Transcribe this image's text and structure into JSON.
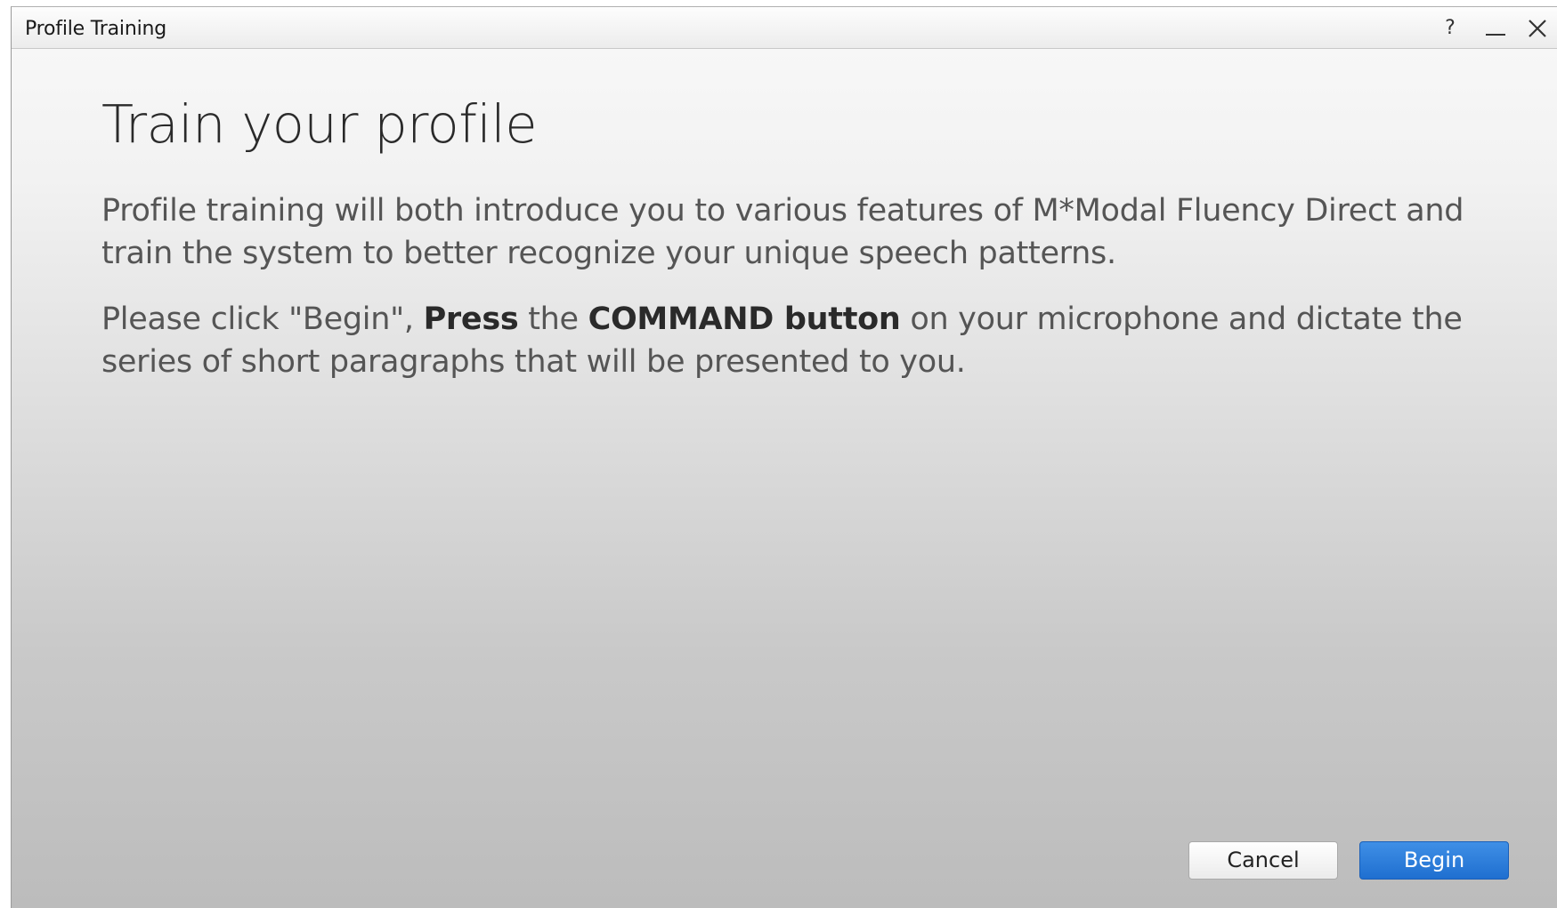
{
  "window": {
    "title": "Profile Training",
    "help_label": "?"
  },
  "main": {
    "heading": "Train your profile",
    "paragraph1": "Profile training will both introduce you to various features of M*Modal Fluency Direct and train the system to better recognize your unique speech patterns.",
    "paragraph2": {
      "part1": "Please click \"Begin\", ",
      "bold1": "Press",
      "part2": " the ",
      "bold2": "COMMAND button",
      "part3": " on your microphone and dictate the series of short paragraphs that will be presented to you."
    }
  },
  "buttons": {
    "cancel": "Cancel",
    "begin": "Begin"
  },
  "colors": {
    "accent": "#2a7ddb",
    "text": "#555555",
    "heading": "#2a2a2a"
  },
  "icons": [
    "help-icon",
    "minimize-icon",
    "close-icon"
  ]
}
